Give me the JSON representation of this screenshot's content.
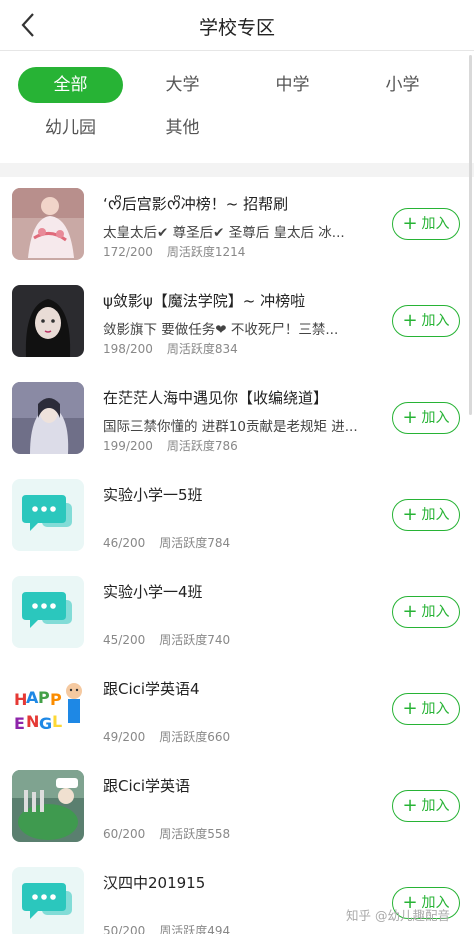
{
  "header": {
    "title": "学校专区"
  },
  "filters": [
    {
      "label": "全部",
      "active": true
    },
    {
      "label": "大学",
      "active": false
    },
    {
      "label": "中学",
      "active": false
    },
    {
      "label": "小学",
      "active": false
    },
    {
      "label": "幼儿园",
      "active": false
    },
    {
      "label": "其他",
      "active": false
    }
  ],
  "join_label": "加入",
  "groups": [
    {
      "name": "‘ᰔᩚ后宫影ᰔᩚ冲榜！~ 招帮刷",
      "desc": "太皇太后✔ 尊圣后✔ 圣尊后 皇太后 冰...",
      "members": "172/200",
      "activity": "周活跃度1214",
      "avatar": "photo-avatar-1"
    },
    {
      "name": "ψ敛影ψ【魔法学院】~ 冲榜啦",
      "desc": "敛影旗下 要做任务❤ 不收死尸！三禁...",
      "members": "198/200",
      "activity": "周活跃度834",
      "avatar": "photo-avatar-2"
    },
    {
      "name": "在茫茫人海中遇见你【收编绕道】",
      "desc": "国际三禁你懂的 进群10贡献是老规矩 进...",
      "members": "199/200",
      "activity": "周活跃度786",
      "avatar": "photo-avatar-3"
    },
    {
      "name": "实验小学一5班",
      "desc": "",
      "members": "46/200",
      "activity": "周活跃度784",
      "avatar": "chat-bubble-icon"
    },
    {
      "name": "实验小学一4班",
      "desc": "",
      "members": "45/200",
      "activity": "周活跃度740",
      "avatar": "chat-bubble-icon"
    },
    {
      "name": "跟Cici学英语4",
      "desc": "",
      "members": "49/200",
      "activity": "周活跃度660",
      "avatar": "happy-english-logo"
    },
    {
      "name": "跟Cici学英语",
      "desc": "",
      "members": "60/200",
      "activity": "周活跃度558",
      "avatar": "photo-avatar-7"
    },
    {
      "name": "汉四中201915",
      "desc": "",
      "members": "50/200",
      "activity": "周活跃度494",
      "avatar": "chat-bubble-icon"
    }
  ],
  "watermark": "知乎 @幼儿趣配音",
  "colors": {
    "accent": "#27b335",
    "bubble": "#2bc7bd"
  }
}
